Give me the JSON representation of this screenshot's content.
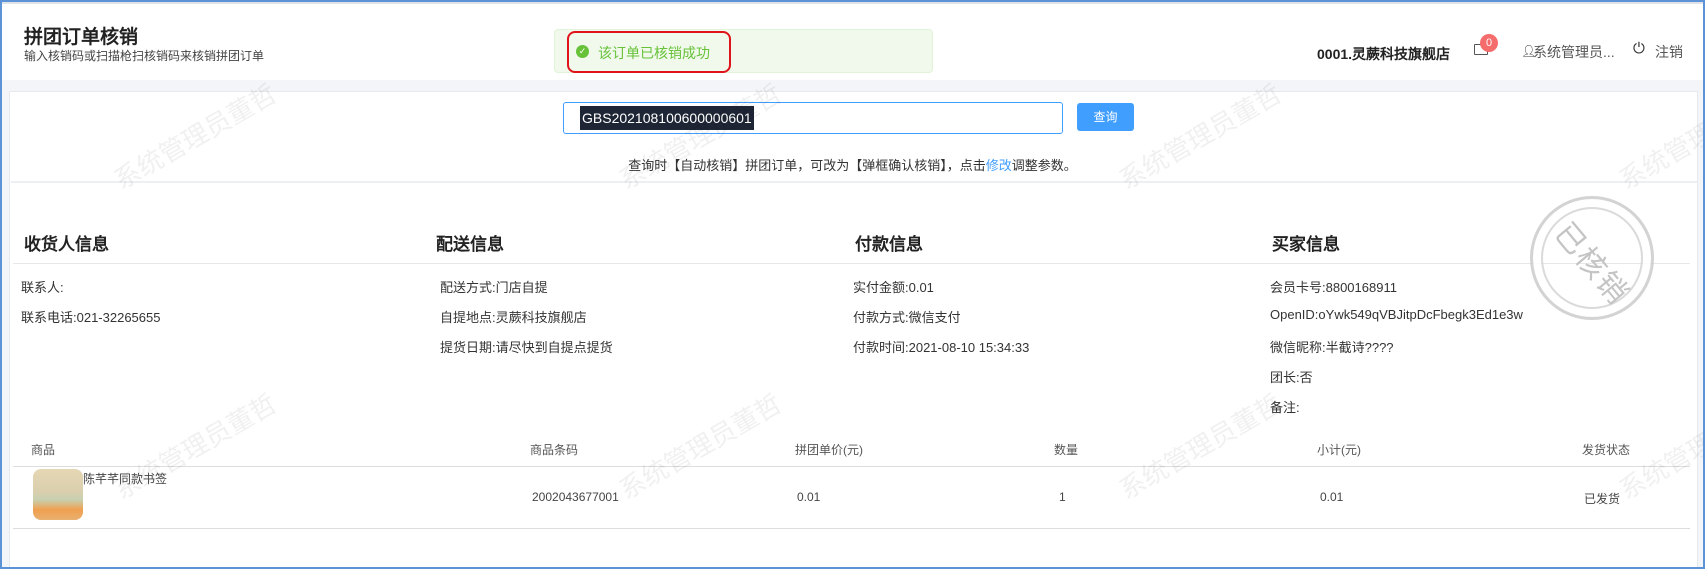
{
  "header": {
    "title": "拼团订单核销",
    "subtitle": "输入核销码或扫描枪扫核销码来核销拼团订单",
    "store": "0001.灵蕨科技旗舰店",
    "message_count": "0",
    "user": "系统管理员...",
    "logout": "注销"
  },
  "toast": {
    "message": "该订单已核销成功"
  },
  "search": {
    "value": "GBS202108100600000601",
    "button": "查询",
    "hint_prefix": "查询时【自动核销】拼团订单，可改为【弹框确认核销】，点击",
    "hint_link": "修改",
    "hint_suffix": "调整参数。"
  },
  "sections": {
    "receiver": {
      "title": "收货人信息",
      "rows": [
        "联系人:",
        "联系电话:021-32265655"
      ]
    },
    "delivery": {
      "title": "配送信息",
      "rows": [
        "配送方式:门店自提",
        "自提地点:灵蕨科技旗舰店",
        "提货日期:请尽快到自提点提货"
      ]
    },
    "payment": {
      "title": "付款信息",
      "rows": [
        "实付金额:0.01",
        "付款方式:微信支付",
        "付款时间:2021-08-10 15:34:33"
      ]
    },
    "buyer": {
      "title": "买家信息",
      "rows": [
        "会员卡号:8800168911",
        "OpenID:oYwk549qVBJitpDcFbegk3Ed1e3w",
        "微信昵称:半截诗????",
        "团长:否",
        "备注:"
      ]
    }
  },
  "stamp": "已核销",
  "watermark": "系统管理员董哲",
  "table": {
    "headers": [
      "商品",
      "商品条码",
      "拼团单价(元)",
      "数量",
      "小计(元)",
      "发货状态"
    ],
    "rows": [
      {
        "name": "陈芊芊同款书签",
        "barcode": "2002043677001",
        "price": "0.01",
        "qty": "1",
        "subtotal": "0.01",
        "status": "已发货"
      }
    ]
  },
  "colors": {
    "primary": "#409eff",
    "success": "#67c23a",
    "badge": "#f56c6c"
  }
}
